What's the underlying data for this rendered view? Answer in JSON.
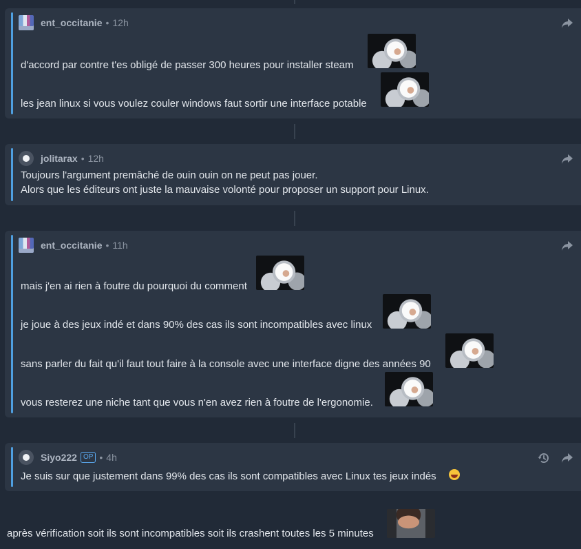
{
  "comments": [
    {
      "username": "ent_occitanie",
      "time": "12h",
      "lines": [
        "d'accord par contre t'es obligé de passer 300 heures pour installer steam",
        "les jean linux si vous voulez couler windows faut sortir une interface potable"
      ]
    },
    {
      "username": "jolitarax",
      "time": "12h",
      "lines": [
        "Toujours l'argument premâché de ouin ouin on ne peut pas jouer.",
        "Alors que les éditeurs ont juste la mauvaise volonté pour proposer un support pour Linux."
      ]
    },
    {
      "username": "ent_occitanie",
      "time": "11h",
      "lines": [
        "mais j'en ai rien à foutre du pourquoi du comment",
        "je joue à des jeux indé et dans 90% des cas ils sont incompatibles avec linux",
        "sans parler du fait qu'il faut tout faire à la console avec une interface digne des années 90",
        "vous resterez une niche tant que vous n'en avez rien à foutre de l'ergonomie."
      ]
    },
    {
      "username": "Siyo222",
      "badge": "OP",
      "time": "4h",
      "lines": [
        "Je suis sur que justement dans 99% des cas ils sont compatibles avec Linux tes jeux indés"
      ]
    }
  ],
  "followup": "après vérification soit ils sont incompatibles soit ils crashent toutes les 5 minutes",
  "separator": "•",
  "icons": {
    "share": "share-arrow-icon",
    "history": "history-icon",
    "reaction_image": "astronaut-laughing-image",
    "face_image": "man-face-image",
    "emoji": "laughing-emoji"
  },
  "colors": {
    "background": "#212a37",
    "card": "#2c3644",
    "accent_bar": "#4f9fe0",
    "op_badge": "#5aa8ee"
  }
}
